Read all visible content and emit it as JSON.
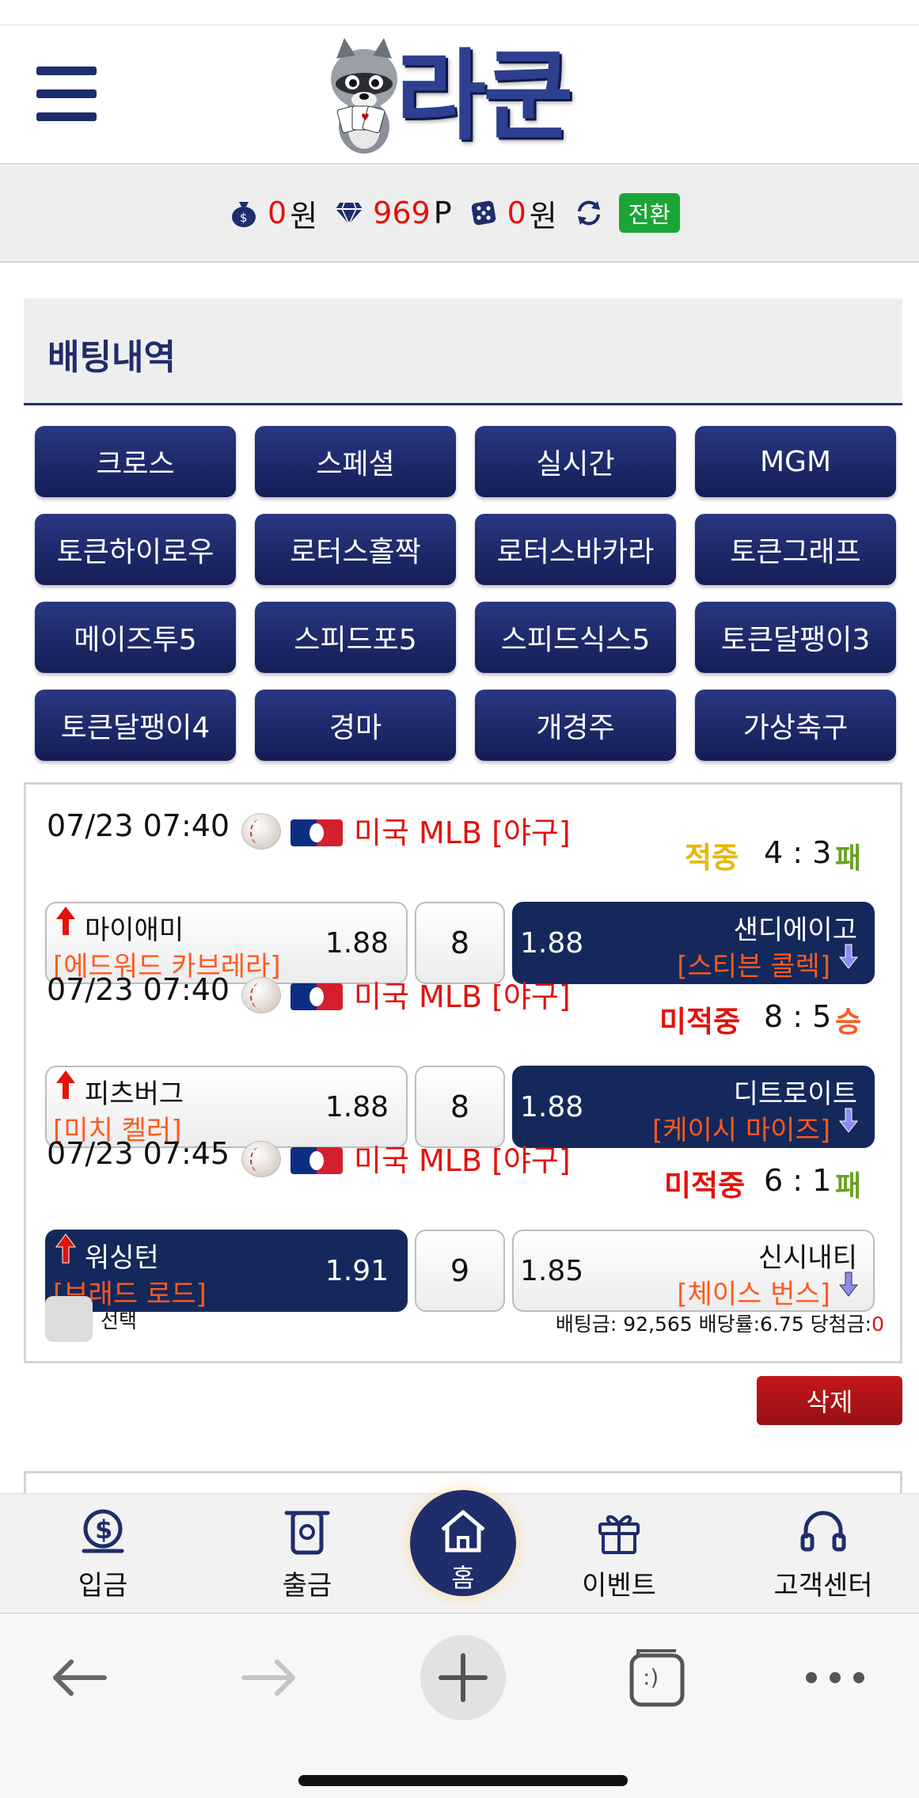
{
  "header": {
    "logo_text": "라쿤"
  },
  "wallet": {
    "cash": "0",
    "cash_unit": "원",
    "points": "969",
    "points_unit": "P",
    "casino": "0",
    "casino_unit": "원",
    "switch_label": "전환"
  },
  "section": {
    "title": "배팅내역"
  },
  "game_buttons": [
    "크로스",
    "스페셜",
    "실시간",
    "MGM",
    "토큰하이로우",
    "로터스홀짝",
    "로터스바카라",
    "토큰그래프",
    "메이즈투5",
    "스피드포5",
    "스피드식스5",
    "토큰달팽이3",
    "토큰달팽이4",
    "경마",
    "개경주",
    "가상축구"
  ],
  "bets": [
    {
      "datetime": "07/23 07:40",
      "league": "미국 MLB [야구]",
      "status": "적중",
      "status_color": "#e3b900",
      "score": "4 : 3",
      "result": "패",
      "result_color": "#6aa322",
      "home": {
        "name": "마이애미",
        "pitcher": "[에드워드 카브레라]",
        "odds": "1.88"
      },
      "handicap": "8",
      "away": {
        "name": "샌디에이고",
        "pitcher": "[스티븐 콜렉]",
        "odds": "1.88"
      },
      "selected": "away"
    },
    {
      "datetime": "07/23 07:40",
      "league": "미국 MLB [야구]",
      "status": "미적중",
      "status_color": "#e3120b",
      "score": "8 : 5",
      "result": "승",
      "result_color": "#ff5a1f",
      "home": {
        "name": "피츠버그",
        "pitcher": "[미치 켈러]",
        "odds": "1.88"
      },
      "handicap": "8",
      "away": {
        "name": "디트로이트",
        "pitcher": "[케이시 마이즈]",
        "odds": "1.88"
      },
      "selected": "away"
    },
    {
      "datetime": "07/23 07:45",
      "league": "미국 MLB [야구]",
      "status": "미적중",
      "status_color": "#e3120b",
      "score": "6 : 1",
      "result": "패",
      "result_color": "#6aa322",
      "home": {
        "name": "워싱턴",
        "pitcher": "[브래드 로드]",
        "odds": "1.91"
      },
      "handicap": "9",
      "away": {
        "name": "신시내티",
        "pitcher": "[체이스 번스]",
        "odds": "1.85"
      },
      "selected": "home"
    }
  ],
  "bet_footer": {
    "select_label": "선택",
    "summary_prefix": "배팅금: 92,565 배당률:6.75 당첨금:",
    "win_amount": "0"
  },
  "delete_label": "삭제",
  "bottom_nav": {
    "deposit": "입금",
    "withdraw": "출금",
    "home": "홈",
    "event": "이벤트",
    "support": "고객센터"
  },
  "browser": {
    "tabs_glyph": ":)"
  }
}
